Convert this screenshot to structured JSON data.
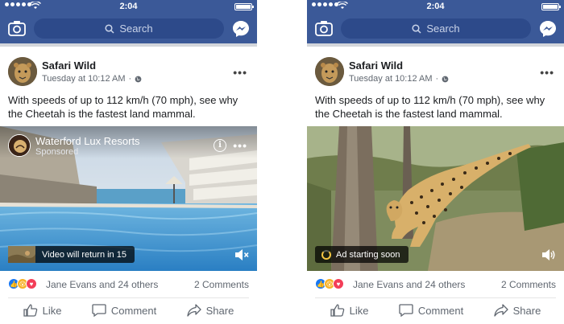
{
  "status_bar": {
    "time": "2:04"
  },
  "search": {
    "placeholder": "Search"
  },
  "post": {
    "author": "Safari Wild",
    "timestamp": "Tuesday at 10:12 AM",
    "text": "With speeds of up to 112 km/h (70 mph), see why the Cheetah is the fastest land mammal."
  },
  "left_ad": {
    "advertiser": "Waterford Lux Resorts",
    "sponsored_label": "Sponsored",
    "overlay_text": "Video will return in 15"
  },
  "right_video": {
    "overlay_text": "Ad starting soon"
  },
  "engagement": {
    "reactors": "Jane Evans and 24 others",
    "comments": "2 Comments"
  },
  "actions": {
    "like": "Like",
    "comment": "Comment",
    "share": "Share"
  },
  "colors": {
    "brand_blue": "#3b5998",
    "search_bg": "#2d4a8a",
    "like_blue": "#1877f2",
    "love_red": "#f33e58",
    "wow_yellow": "#f7b125"
  },
  "icons": [
    "camera-icon",
    "search-icon",
    "messenger-icon",
    "globe-icon",
    "more-icon",
    "info-icon",
    "volume-icon",
    "muted-icon",
    "spinner-icon",
    "like-icon",
    "comment-icon",
    "share-icon"
  ]
}
